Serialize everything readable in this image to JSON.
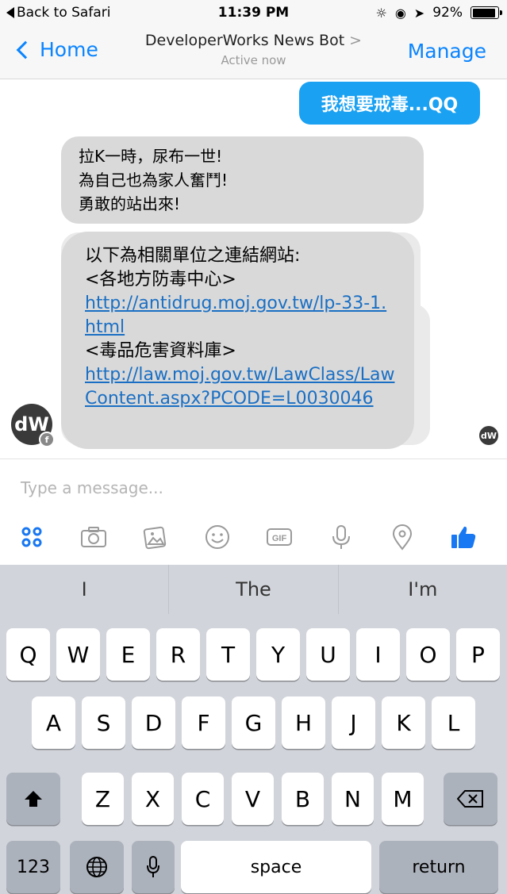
{
  "status_bar": {
    "back_label": "Back to Safari",
    "time": "11:39 PM",
    "battery": "92%",
    "battery_level": 0.92
  },
  "nav": {
    "back_label": "Home",
    "title": "DeveloperWorks News Bot",
    "title_chevron": ">",
    "subtitle": "Active now",
    "manage_label": "Manage"
  },
  "messages": {
    "outgoing": "我想要戒毒...QQ",
    "incoming1": [
      "拉K一時，尿布一世!",
      "為自己也為家人奮鬥!",
      "勇敢的站出來!"
    ],
    "incoming2": {
      "intro": "以下為相關單位之連結網站:",
      "label1": "<各地方防毒中心>",
      "link1": "http://antidrug.moj.gov.tw/lp-33-1.html",
      "label2": "<毒品危害資料庫>",
      "link2": "http://law.moj.gov.tw/LawClass/LawContent.aspx?PCODE=L0030046"
    },
    "avatar_text": "dW",
    "seen_avatar_text": "dW"
  },
  "composer": {
    "placeholder": "Type a message...",
    "tools": [
      "apps-icon",
      "camera-icon",
      "gallery-icon",
      "emoji-icon",
      "gif-icon",
      "microphone-icon",
      "location-icon",
      "like-icon"
    ],
    "gif_label": "GIF"
  },
  "keyboard": {
    "suggestions": [
      "I",
      "The",
      "I'm"
    ],
    "row1": [
      "Q",
      "W",
      "E",
      "R",
      "T",
      "Y",
      "U",
      "I",
      "O",
      "P"
    ],
    "row2": [
      "A",
      "S",
      "D",
      "F",
      "G",
      "H",
      "J",
      "K",
      "L"
    ],
    "row3": [
      "Z",
      "X",
      "C",
      "V",
      "B",
      "N",
      "M"
    ],
    "numbers_label": "123",
    "space_label": "space",
    "return_label": "return"
  },
  "colors": {
    "accent": "#0a84ff",
    "outgoing_bubble": "#1ba1f2",
    "incoming_bubble": "#d9d9d9",
    "link": "#1a6fc4"
  }
}
